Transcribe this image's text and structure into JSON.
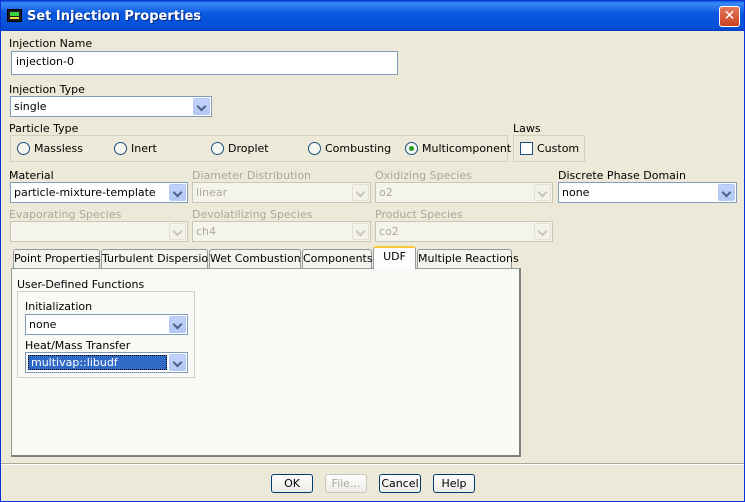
{
  "window": {
    "title": "Set Injection Properties"
  },
  "injection_name": {
    "label": "Injection Name",
    "value": "injection-0"
  },
  "injection_type": {
    "label": "Injection Type",
    "value": "single"
  },
  "particle_type": {
    "label": "Particle Type",
    "options": [
      "Massless",
      "Inert",
      "Droplet",
      "Combusting",
      "Multicomponent"
    ],
    "selected": "Multicomponent"
  },
  "laws": {
    "label": "Laws",
    "custom_label": "Custom"
  },
  "material": {
    "label": "Material",
    "value": "particle-mixture-template"
  },
  "diameter_distribution": {
    "label": "Diameter Distribution",
    "value": "linear"
  },
  "oxidizing_species": {
    "label": "Oxidizing Species",
    "value": "o2"
  },
  "discrete_phase_domain": {
    "label": "Discrete Phase Domain",
    "value": "none"
  },
  "evaporating_species": {
    "label": "Evaporating Species",
    "value": ""
  },
  "devolatilizing_species": {
    "label": "Devolatilizing Species",
    "value": "ch4"
  },
  "product_species": {
    "label": "Product Species",
    "value": "co2"
  },
  "tabs": [
    "Point Properties",
    "Turbulent Dispersion",
    "Wet Combustion",
    "Components",
    "UDF",
    "Multiple Reactions"
  ],
  "active_tab": "UDF",
  "udf": {
    "group_label": "User-Defined Functions",
    "initialization": {
      "label": "Initialization",
      "value": "none"
    },
    "heat_mass_transfer": {
      "label": "Heat/Mass Transfer",
      "value": "multivap::libudf"
    }
  },
  "buttons": {
    "ok": "OK",
    "file": "File...",
    "cancel": "Cancel",
    "help": "Help"
  },
  "colors": {
    "titlebar": "#0b58e0",
    "background": "#ece9d8",
    "selection": "#316ac5",
    "active_tab_accent": "#ffc83c"
  }
}
